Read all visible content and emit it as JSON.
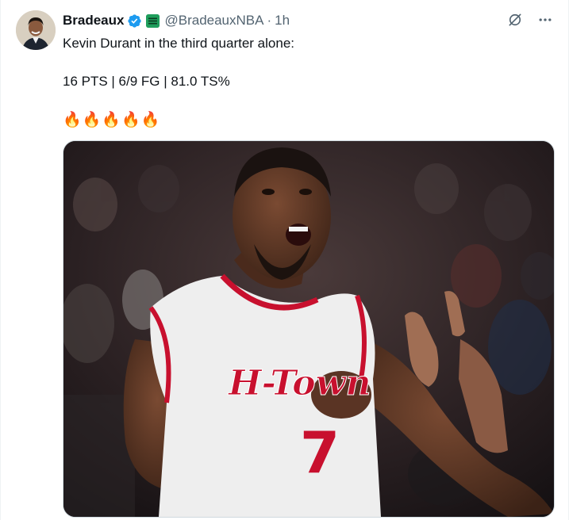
{
  "user": {
    "display_name": "Bradeaux",
    "handle": "@BradeauxNBA",
    "separator": "·",
    "time": "1h"
  },
  "tweet": {
    "line1": "Kevin Durant in the third quarter alone:",
    "line2": "16 PTS | 6/9 FG | 81.0 TS%",
    "emoji_line": "🔥🔥🔥🔥🔥"
  },
  "media": {
    "jersey_text": "H-Town",
    "jersey_number": "7"
  },
  "icons": {
    "verified": "verified-badge-icon",
    "affiliate": "affiliate-badge-icon",
    "grok": "grok-icon",
    "more": "more-dots-icon"
  },
  "colors": {
    "verified_blue": "#1d9bf0",
    "affiliate_green": "#1f9e5c",
    "secondary_text": "#536471",
    "jersey_red": "#c8102e"
  }
}
